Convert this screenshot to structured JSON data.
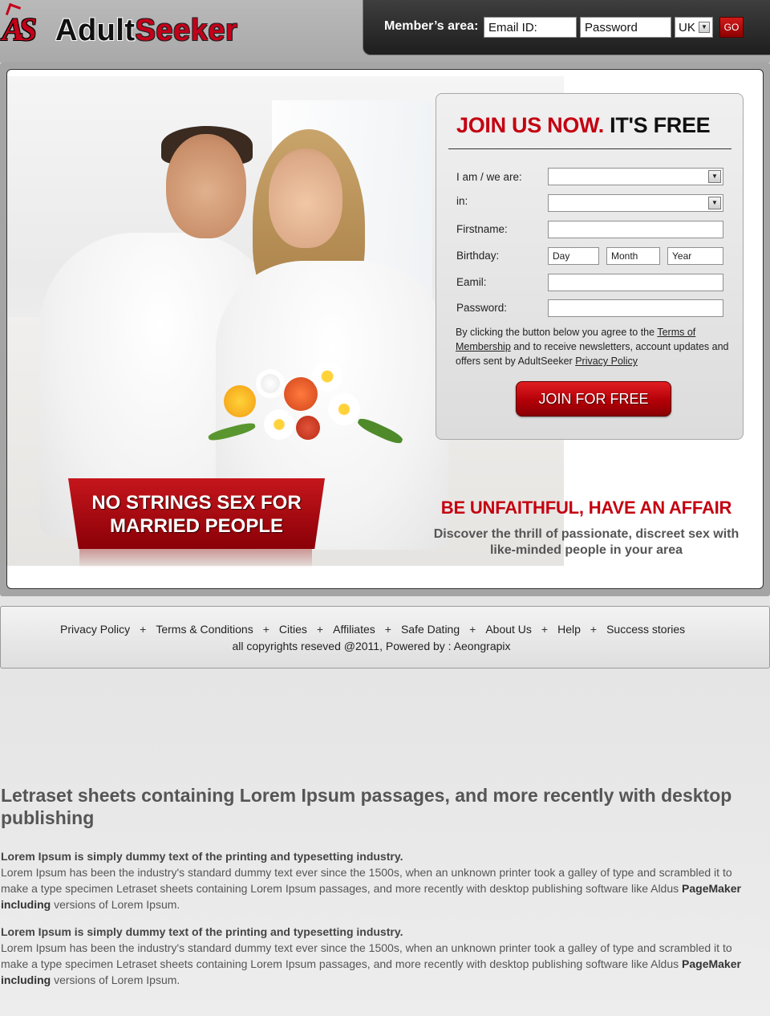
{
  "header": {
    "logo_mark": "AS",
    "logo_part1": "Adult",
    "logo_part2": "Seeker",
    "member_label": "Member’s area:",
    "email_placeholder": "Email ID:",
    "password_placeholder": "Password",
    "country_value": "UK",
    "go_label": "GO"
  },
  "hero": {
    "banner_line1": "NO STRINGS SEX FOR",
    "banner_line2": "MARRIED PEOPLE",
    "tagline_title": "BE UNFAITHFUL, HAVE AN AFFAIR",
    "tagline_text": "Discover the thrill of passionate, discreet sex with like-minded people in your area"
  },
  "join_form": {
    "title_red": "JOIN US NOW.",
    "title_black": "IT'S FREE",
    "label_iam": "I am / we are:",
    "label_in": "in:",
    "label_firstname": "Firstname:",
    "label_birthday": "Birthday:",
    "birthday_day": "Day",
    "birthday_month": "Month",
    "birthday_year": "Year",
    "label_email": "Eamil:",
    "label_password": "Password:",
    "terms_prefix": "By clicking the button below you agree to the",
    "terms_link": "Terms of Membership",
    "terms_middle": "and to receive newsletters, account updates and offers sent by AdultSeeker",
    "privacy_link": "Privacy Policy",
    "join_button": "JOIN FOR FREE"
  },
  "footer": {
    "links": [
      "Privacy Policy",
      "Terms & Conditions",
      "Cities",
      "Affiliates",
      "Safe Dating",
      "About Us",
      "Help",
      "Success stories"
    ],
    "separator": "+",
    "copyright": "all copyrights reseved @2011, Powered by : Aeongrapix"
  },
  "content": {
    "heading": "Letraset sheets containing Lorem Ipsum passages, and more recently with desktop publishing",
    "paragraphs": [
      {
        "lead": "Lorem Ipsum is simply dummy text of the printing and typesetting industry.",
        "body": "Lorem Ipsum has been the industry's standard dummy text ever since the 1500s, when an unknown printer took a galley of type and scrambled it to make a type specimen Letraset sheets containing Lorem Ipsum passages, and more recently with desktop publishing software like Aldus",
        "bold_tail": "PageMaker including",
        "end": "versions of Lorem Ipsum."
      },
      {
        "lead": "Lorem Ipsum is simply dummy text of the printing and typesetting industry.",
        "body": "Lorem Ipsum has been the industry's standard dummy text ever since the 1500s, when an unknown printer took a galley of type and scrambled it to make a type specimen Letraset sheets containing Lorem Ipsum passages, and more recently with desktop publishing software like Aldus",
        "bold_tail": "PageMaker including",
        "end": "versions of Lorem Ipsum."
      }
    ]
  },
  "colors": {
    "brand_red": "#c40010",
    "header_dark": "#2a2a2a",
    "frame_gray": "#a5a5a5"
  },
  "icons": {
    "dropdown": "dropdown-arrow-icon"
  }
}
